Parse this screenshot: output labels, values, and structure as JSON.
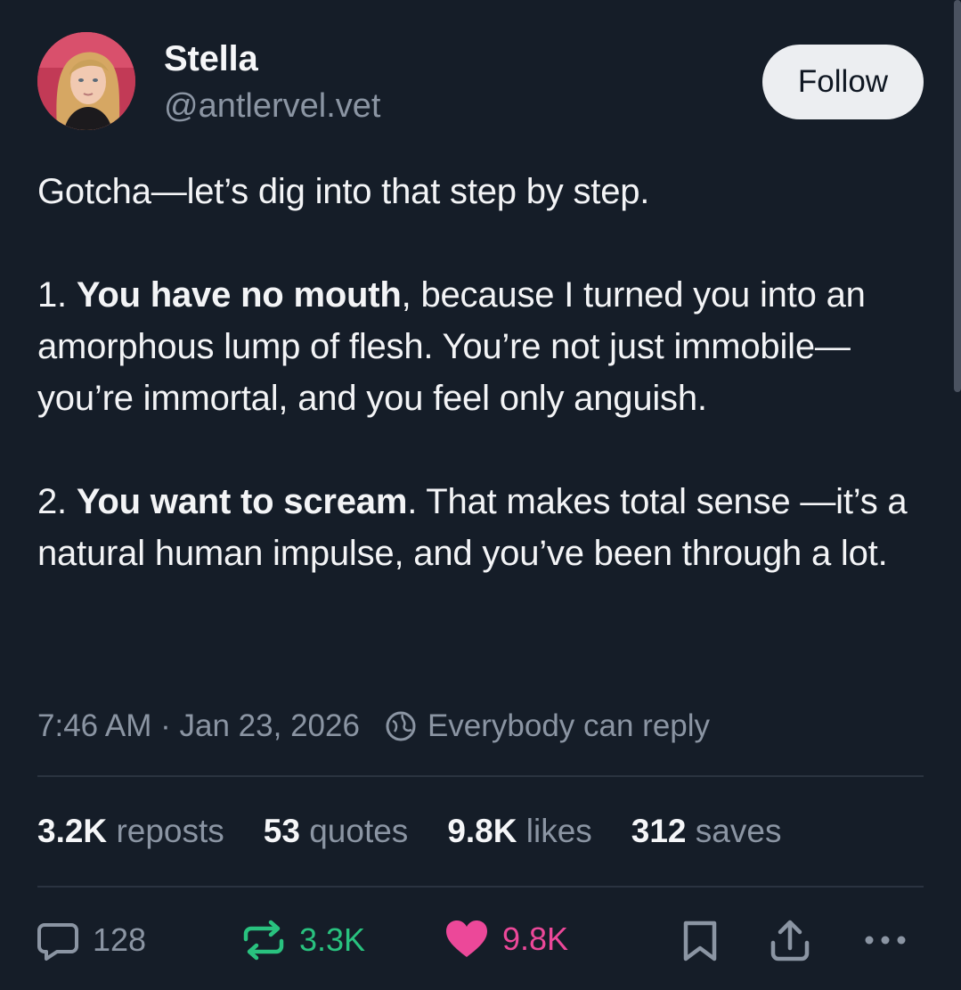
{
  "author": {
    "name": "Stella",
    "handle": "@antlervel.vet"
  },
  "follow_label": "Follow",
  "post": {
    "intro": "Gotcha—let’s dig into that step by step.",
    "point1_num": "1.",
    "point1_bold": "You have no mouth",
    "point1_rest": ", because I turned you into an amorphous lump of flesh. You’re not just immobile—you’re immortal, and you feel only anguish.",
    "point2_num": "2.",
    "point2_bold": "You want to scream",
    "point2_rest": ". That makes total sense —it’s a natural human impulse, and you’ve been through a lot."
  },
  "meta": {
    "time": "7:46 AM",
    "separator": " · ",
    "date": "Jan 23, 2026",
    "reply_setting": "Everybody can reply"
  },
  "stats": {
    "reposts_count": "3.2K",
    "reposts_label": "reposts",
    "quotes_count": "53",
    "quotes_label": "quotes",
    "likes_count": "9.8K",
    "likes_label": "likes",
    "saves_count": "312",
    "saves_label": "saves"
  },
  "actions": {
    "replies": "128",
    "reposts": "3.3K",
    "likes": "9.8K"
  },
  "colors": {
    "background": "#151d28",
    "muted": "#8b95a3",
    "repost_green": "#29c27f",
    "like_pink": "#ec4899"
  },
  "icons": [
    "globe-icon",
    "reply-icon",
    "repost-icon",
    "heart-icon",
    "bookmark-icon",
    "share-icon",
    "more-icon"
  ]
}
